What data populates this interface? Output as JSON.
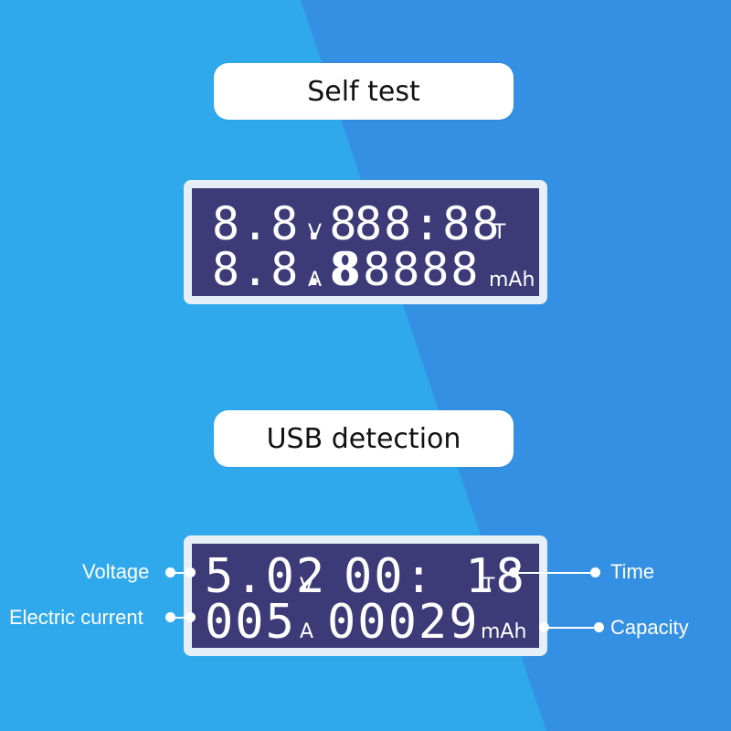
{
  "sections": [
    {
      "title": "Self test",
      "display": {
        "voltage": "8.8.8",
        "voltage_unit": "V",
        "time": "88:88",
        "time_unit": "T",
        "current": "8.8.8",
        "current_unit": "A",
        "capacity": "88888",
        "capacity_unit": "mAh"
      }
    },
    {
      "title": "USB detection",
      "display": {
        "voltage": "5.02",
        "voltage_unit": "V",
        "time": "00: 18",
        "time_unit": "T",
        "current": "005",
        "current_unit": "A",
        "capacity": "00029",
        "capacity_unit": "mAh"
      },
      "callouts": {
        "voltage": "Voltage",
        "current": "Electric current",
        "time": "Time",
        "capacity": "Capacity"
      }
    }
  ],
  "colors": {
    "background_left": "#2fa9ec",
    "background_right": "#3490e2",
    "lcd_screen": "#3c3b78",
    "lcd_bezel": "#e6eef6"
  }
}
